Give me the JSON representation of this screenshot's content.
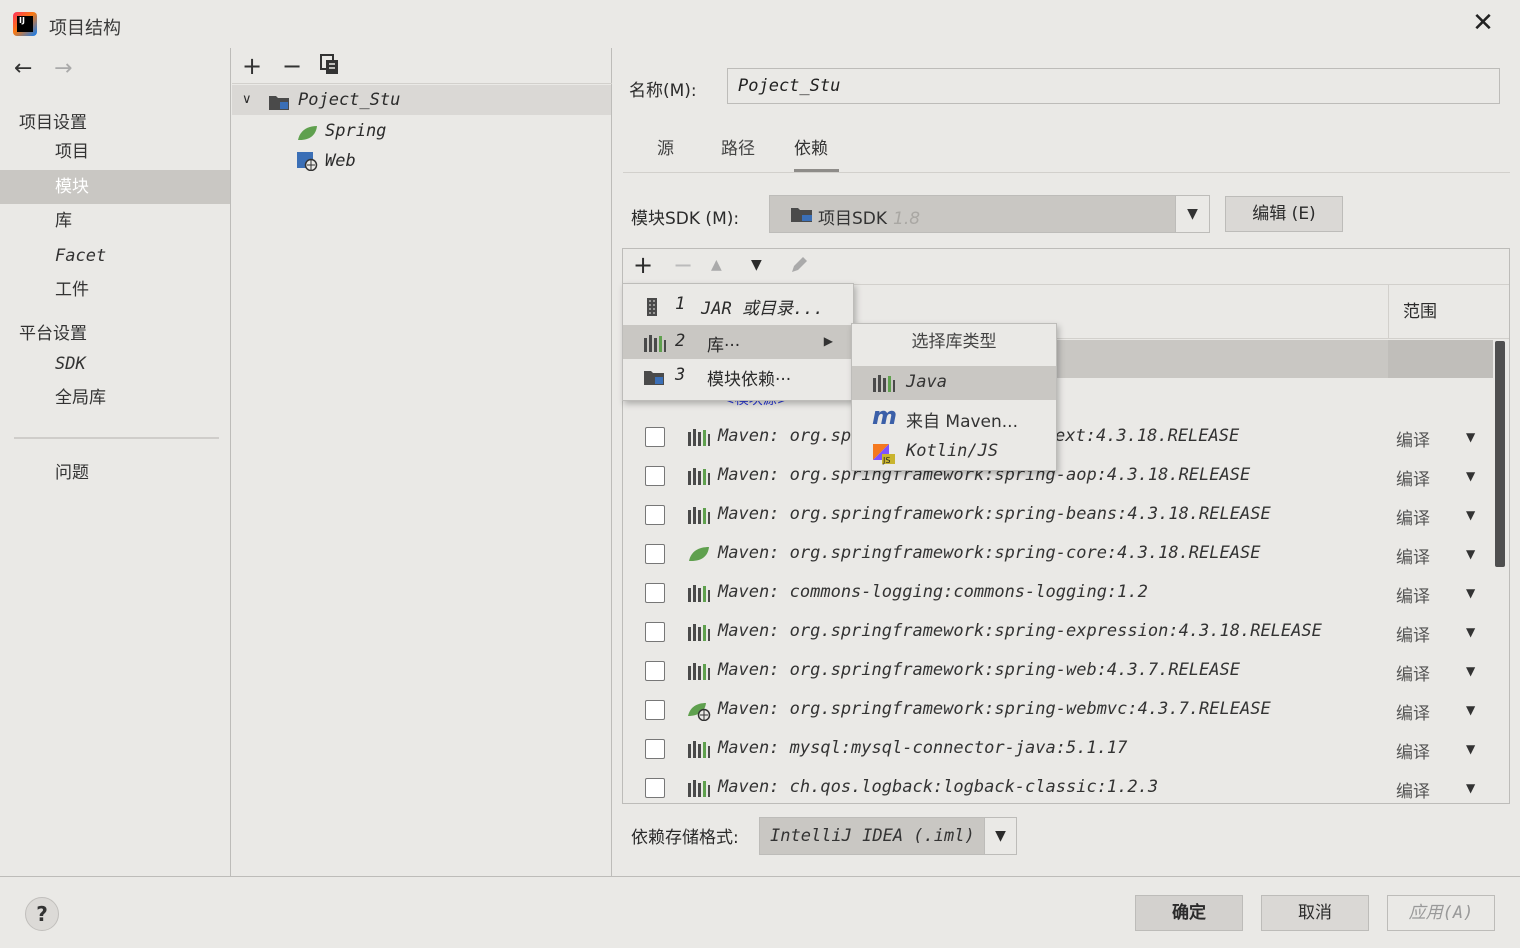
{
  "window": {
    "title": "项目结构"
  },
  "nav": {
    "section_project": "项目设置",
    "items_project": [
      "项目",
      "模块",
      "库",
      "Facet",
      "工件"
    ],
    "section_platform": "平台设置",
    "items_platform": [
      "SDK",
      "全局库"
    ],
    "problems": "问题",
    "selected": "模块"
  },
  "tree": {
    "root": "Poject_Stu",
    "children": [
      "Spring",
      "Web"
    ]
  },
  "module": {
    "name_label": "名称(M):",
    "name_value": "Poject_Stu",
    "tabs": [
      "源",
      "路径",
      "依赖"
    ],
    "active_tab": "依赖",
    "sdk_label": "模块SDK (M):",
    "sdk_value": "项目SDK",
    "sdk_version": "1.8",
    "sdk_edit": "编辑 (E)"
  },
  "deps": {
    "scope_header": "范围",
    "partial_source": "<模块源>",
    "rows": [
      {
        "text": "Maven: org.spri",
        "text2": "ext:4.3.18.RELEASE",
        "scope": "编译",
        "icon": "library-icon"
      },
      {
        "text": "Maven: org.springframework:spring-aop:4.3.18.RELEASE",
        "scope": "编译",
        "icon": "library-icon"
      },
      {
        "text": "Maven: org.springframework:spring-beans:4.3.18.RELEASE",
        "scope": "编译",
        "icon": "library-icon"
      },
      {
        "text": "Maven: org.springframework:spring-core:4.3.18.RELEASE",
        "scope": "编译",
        "icon": "spring-leaf-icon"
      },
      {
        "text": "Maven: commons-logging:commons-logging:1.2",
        "scope": "编译",
        "icon": "library-icon"
      },
      {
        "text": "Maven: org.springframework:spring-expression:4.3.18.RELEASE",
        "scope": "编译",
        "icon": "library-icon"
      },
      {
        "text": "Maven: org.springframework:spring-web:4.3.7.RELEASE",
        "scope": "编译",
        "icon": "library-icon"
      },
      {
        "text": "Maven: org.springframework:spring-webmvc:4.3.7.RELEASE",
        "scope": "编译",
        "icon": "spring-web-icon"
      },
      {
        "text": "Maven: mysql:mysql-connector-java:5.1.17",
        "scope": "编译",
        "icon": "library-icon"
      },
      {
        "text": "Maven: ch.qos.logback:logback-classic:1.2.3",
        "scope": "编译",
        "icon": "library-icon"
      }
    ]
  },
  "add_menu": {
    "items": [
      {
        "num": "1",
        "label": "JAR 或目录..."
      },
      {
        "num": "2",
        "label": "库···"
      },
      {
        "num": "3",
        "label": "模块依赖···"
      }
    ]
  },
  "lib_type_menu": {
    "title": "选择库类型",
    "items": [
      "Java",
      "来自 Maven...",
      "Kotlin/JS"
    ]
  },
  "storage": {
    "label": "依赖存储格式:",
    "value": "IntelliJ IDEA (.iml)"
  },
  "buttons": {
    "ok": "确定",
    "cancel": "取消",
    "apply": "应用(A)",
    "help": "?"
  },
  "colors": {
    "background": "#eae9e6",
    "selection": "#c9c7c3",
    "link": "#2b38d4",
    "spring_green": "#5fa04e"
  }
}
